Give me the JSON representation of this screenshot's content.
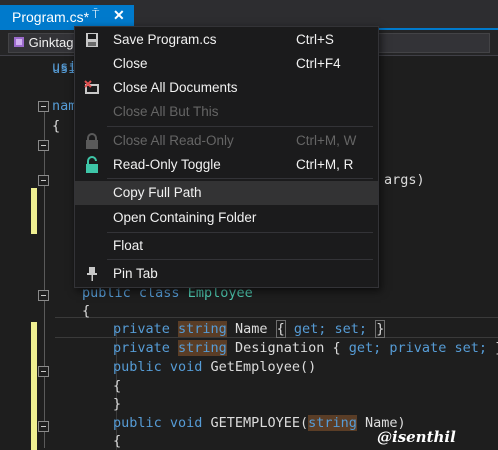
{
  "tab": {
    "title": "Program.cs*",
    "pin_glyph": "⍑",
    "close_glyph": "✕"
  },
  "navbar": {
    "project": "Ginktag"
  },
  "code": {
    "l1": "usi",
    "l2": "usi",
    "l3": "nam",
    "l4": "{",
    "main_args": "args)",
    "class_kw": "public class",
    "class_name": "Employee",
    "brace_open": "{",
    "p1_kw": "private",
    "p1_ty": "string",
    "p1_name": "Name",
    "p1_acc": "get; set;",
    "p2_kw": "private",
    "p2_ty": "string",
    "p2_name": "Designation",
    "p2_acc_get": "get;",
    "p2_acc_set": "private set;",
    "m1_kw": "public void",
    "m1_name": "GetEmployee()",
    "m1_open": "{",
    "m1_close": "}",
    "m2_kw": "public void",
    "m2_name": "GETEMPLOYEE(",
    "m2_ty": "string",
    "m2_param": "Name)",
    "m2_open": "{"
  },
  "menu": {
    "items": [
      {
        "label": "Save Program.cs",
        "shortcut": "Ctrl+S",
        "icon": "save-icon",
        "disabled": false
      },
      {
        "label": "Close",
        "shortcut": "Ctrl+F4",
        "icon": "",
        "disabled": false
      },
      {
        "label": "Close All Documents",
        "shortcut": "",
        "icon": "close-all-documents-icon",
        "disabled": false
      },
      {
        "label": "Close All But This",
        "shortcut": "",
        "icon": "",
        "disabled": true
      },
      {
        "label": "Close All Read-Only",
        "shortcut": "Ctrl+M, W",
        "icon": "lock-icon",
        "disabled": true
      },
      {
        "label": "Read-Only Toggle",
        "shortcut": "Ctrl+M, R",
        "icon": "unlock-icon",
        "disabled": false
      },
      {
        "label": "Copy Full Path",
        "shortcut": "",
        "icon": "",
        "disabled": false,
        "highlighted": true
      },
      {
        "label": "Open Containing Folder",
        "shortcut": "",
        "icon": "",
        "disabled": false
      },
      {
        "label": "Float",
        "shortcut": "",
        "icon": "",
        "disabled": false
      },
      {
        "label": "Pin Tab",
        "shortcut": "",
        "icon": "pin-icon",
        "disabled": false
      }
    ]
  },
  "watermark": "@isenthil",
  "colors": {
    "accent": "#007acc",
    "keyword": "#569cd6",
    "type": "#4ec9b0",
    "highlight": "#5a3d26",
    "margin_change": "#efef91"
  }
}
